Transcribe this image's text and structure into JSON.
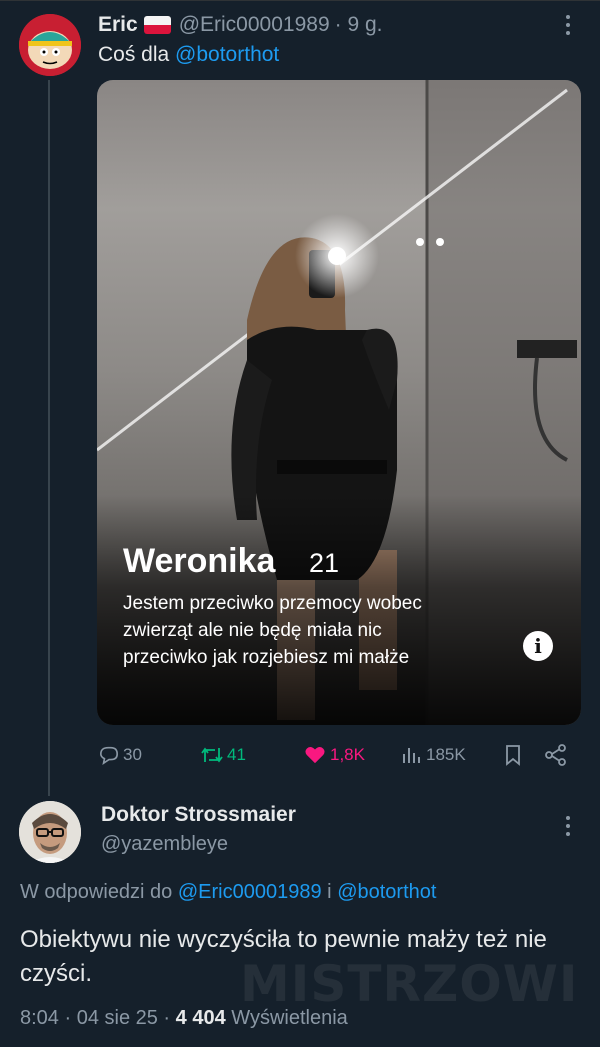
{
  "tweet1": {
    "author_name": "Eric",
    "author_handle": "@Eric00001989",
    "time": "· 9 g.",
    "text_prefix": "Coś dla",
    "mention": "@botorthot",
    "media": {
      "profile_name": "Weronika",
      "profile_age": "21",
      "bio_lines": [
        "Jestem przeciwko przemocy wobec",
        "zwierząt ale nie będę miała nic",
        "przeciwko jak rozjebiesz mi małże"
      ]
    },
    "actions": {
      "replies": "30",
      "retweets": "41",
      "likes": "1,8K",
      "views": "185K"
    }
  },
  "tweet2": {
    "author_name": "Doktor Strossmaier",
    "author_handle": "@yazembleye",
    "reply_prefix": "W odpowiedzi do",
    "reply_user1": "@Eric00001989",
    "reply_and": "i",
    "reply_user2": "@botorthot",
    "text": "Obiektywu nie wyczyściła to pewnie małży też nie czyści.",
    "time": "8:04 · 04 sie 25 ·",
    "views_count": "4 404",
    "views_label": "Wyświetlenia"
  },
  "watermark": "MISTRZOWIE.ORG",
  "icons": [
    "reply-icon",
    "retweet-icon",
    "like-icon",
    "views-icon",
    "bookmark-icon",
    "share-icon",
    "more-icon",
    "info-icon"
  ],
  "colors": {
    "background": "#15202b",
    "link": "#1d9bf0",
    "muted": "#8b98a5",
    "retweet": "#00ba7c",
    "like": "#f91880"
  }
}
